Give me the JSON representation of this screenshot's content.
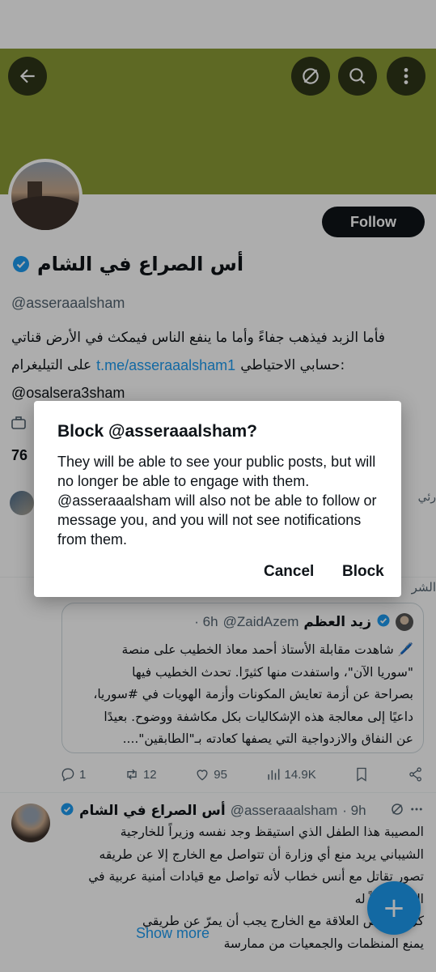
{
  "colors": {
    "banner": "#8b9b36",
    "accent": "#1d9bf0",
    "text": "#0f1419",
    "secondary": "#536471"
  },
  "header": {
    "icons": [
      "back-arrow-icon",
      "grok-icon",
      "search-icon",
      "more-vertical-icon"
    ]
  },
  "profile": {
    "follow_label": "Follow",
    "display_name": "أس الصراع في الشام",
    "handle": "@asseraaalsham",
    "bio_line1": "فأما الزبد فيذهب جفاءً وأما ما ينفع الناس فيمكث في الأرض قناتي",
    "bio_line2_prefix": "على التيليغرام",
    "bio_link": "t.me/asseraaalsham1",
    "bio_line2_suffix": "حسابي الاحتياطي:",
    "bio_line3": "@osalsera3sham",
    "following_count": "76",
    "right_fragment": "رئي"
  },
  "post1": {
    "context": "الشر",
    "quote": {
      "name": "زيد العظم",
      "handle": "@ZaidAzem",
      "time": "· 6h",
      "lines": [
        "🖊️ شاهدت مقابلة الأستاذ أحمد معاذ الخطيب على منصة",
        "\"سوريا الآن\"، واستفدت منها كثيرًا. تحدث الخطيب فيها",
        "بصراحة عن أزمة تعايش المكونات وأزمة الهويات في #سوريا،",
        "داعيًا إلى معالجة هذه الإشكاليات بكل مكاشفة ووضوح. بعيدًا",
        "عن النفاق والازدواجية التي يصفها كعادته بـ\"الطابقين\"...."
      ]
    },
    "actions": {
      "replies": "1",
      "reposts": "12",
      "likes": "95",
      "views": "14.9K"
    }
  },
  "post2": {
    "name": "أس الصراع في الشام",
    "handle": "@asseraaalsham",
    "time": "· 9h",
    "lines": [
      "المصيبة هذا الطفل الذي استيقظ وجد نفسه وزيراً للخارجية",
      "الشيباني يريد منع أي وزارة أن تتواصل مع الخارج إلا عن طريقه",
      "تصور تقاتل مع أنس خطاب لأنه تواصل مع قيادات أمنية عربية في",
      "الخارج بدلاً له",
      "كل ما يخص العلاقة مع الخارج يجب أن يمرّ عن طريقي",
      "يمنع المنظمات والجمعيات من ممارسة"
    ],
    "show_more": "Show more"
  },
  "dialog": {
    "title": "Block @asseraaalsham?",
    "body": "They will be able to see your public posts, but will no longer be able to engage with them. @asseraaalsham will also not be able to follow or message you, and you will not see notifications from them.",
    "cancel": "Cancel",
    "block": "Block"
  }
}
